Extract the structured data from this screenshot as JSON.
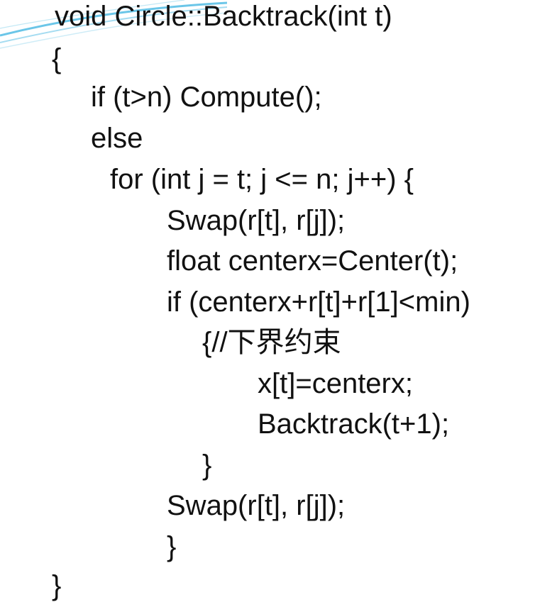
{
  "accent_color": "#5bc0e6",
  "code": {
    "lines": [
      "void Circle::Backtrack(int t)",
      "{",
      "if (t>n) Compute();",
      "else",
      "for (int j = t; j <= n; j++) {",
      "Swap(r[t], r[j]);",
      "float centerx=Center(t);",
      "if (centerx+r[t]+r[1]<min)",
      "{//下界约束",
      "x[t]=centerx;",
      "Backtrack(t+1);",
      "}",
      "Swap(r[t], r[j]);",
      "}",
      "}"
    ]
  }
}
